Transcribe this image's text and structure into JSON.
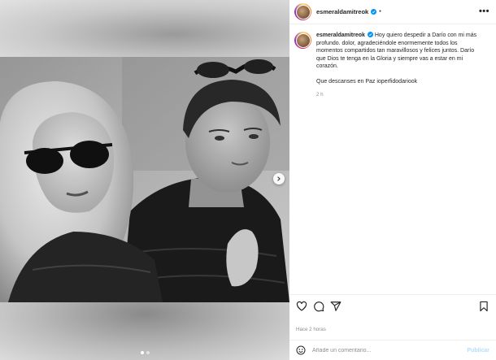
{
  "post": {
    "username": "esmeraldamitreok",
    "verified": true,
    "separator": "•",
    "more_icon": "more-horizontal-icon",
    "caption_paragraphs": [
      "Hoy quiero despedir a Darío con mi más profundo. dolor, agradeciéndole enormemente todos los momentos compartidos tan maravillosos y felices juntos. Darío que Dios te tenga en la Gloria y siempre vas a estar en mi corazón.",
      "Que descanses en Paz ioperfidodariook"
    ],
    "caption_time": "2 h",
    "posted_ago": "Hace 2 horas"
  },
  "media": {
    "carousel_count": 2,
    "carousel_active": 0,
    "next_icon": "chevron-right-icon"
  },
  "actions": {
    "icons": [
      "heart-icon",
      "comment-icon",
      "share-icon",
      "bookmark-icon"
    ]
  },
  "comment_box": {
    "emoji_icon": "emoji-icon",
    "placeholder": "Añade un comentario...",
    "post_label": "Publicar"
  },
  "colors": {
    "verified": "#0095f6",
    "post_button_disabled": "#b2dffc",
    "muted_text": "#8e8e8e",
    "border": "#efefef"
  }
}
